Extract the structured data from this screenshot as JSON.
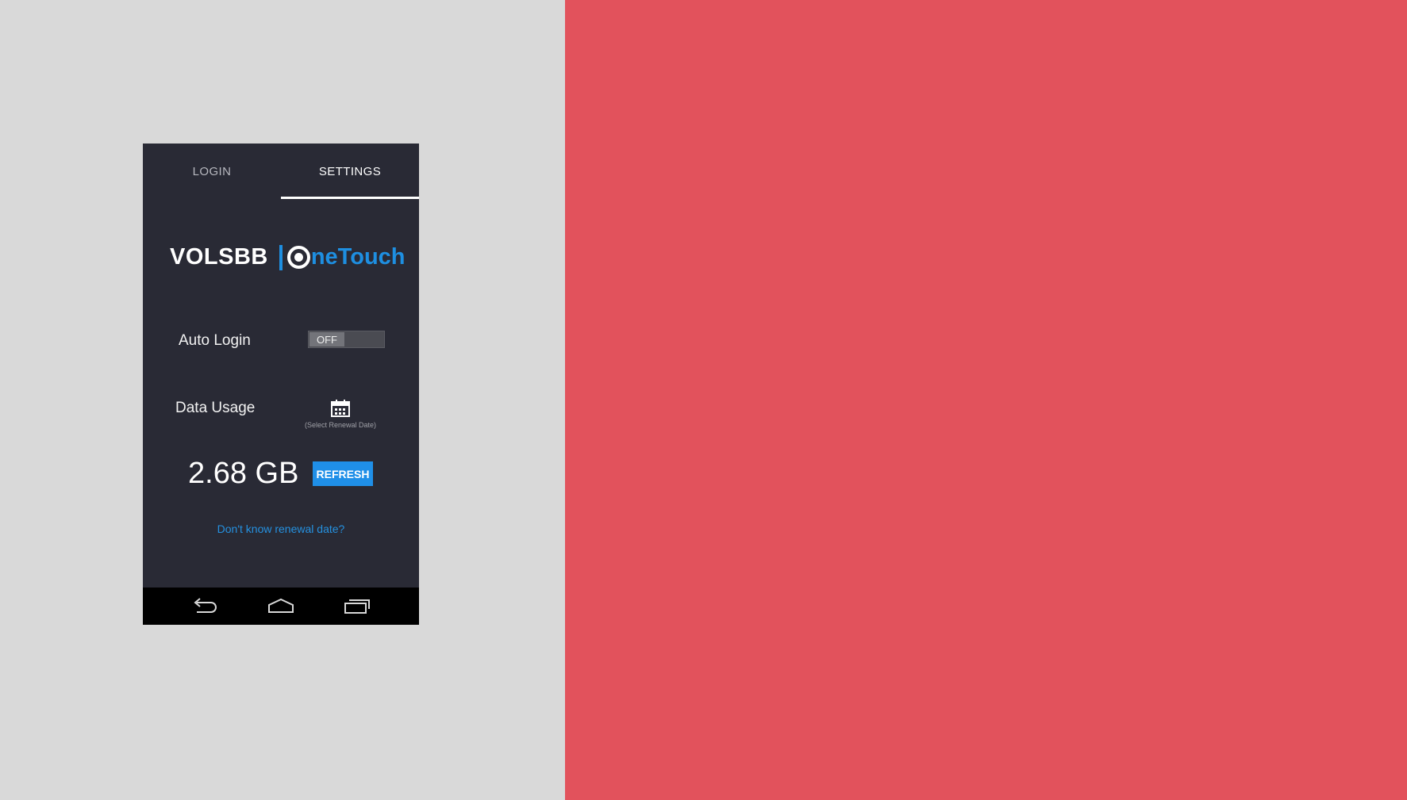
{
  "tabs": [
    {
      "label": "LOGIN",
      "active": false
    },
    {
      "label": "SETTINGS",
      "active": true
    }
  ],
  "logo": {
    "part1": "VOLSBB",
    "part2": "neTouch",
    "accent_color": "#1e8fe1"
  },
  "auto_login": {
    "label": "Auto Login",
    "toggle_state": "OFF"
  },
  "data_usage": {
    "label": "Data Usage",
    "calendar_icon": "calendar-icon",
    "caption": "(Select Renewal Date)",
    "value": "2.68 GB",
    "refresh_label": "REFRESH"
  },
  "renewal_link": "Don't know renewal date?",
  "navbar": {
    "icons": [
      "back-icon",
      "home-icon",
      "recent-apps-icon"
    ]
  },
  "colors": {
    "left_background": "#d9d9d9",
    "right_background": "#e2525c",
    "phone_background": "#292a35",
    "button_blue": "#1f8fe8"
  }
}
